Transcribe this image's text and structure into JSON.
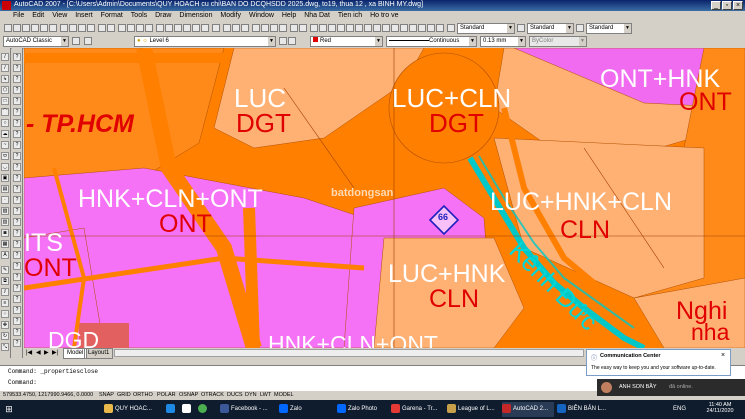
{
  "window": {
    "title": "AutoCAD 2007 - [C:\\Users\\Admin\\Documents\\QUY HOACH cu chi\\BAN DO DCQHSDD 2025.dwg, to19, thua 12 , xa BINH MY.dwg]"
  },
  "menu": [
    "File",
    "Edit",
    "View",
    "Insert",
    "Format",
    "Tools",
    "Draw",
    "Dimension",
    "Modify",
    "Window",
    "Help",
    "Nha Dat",
    "Tien ich",
    "Ho tro ve"
  ],
  "toolbar": {
    "text_style": "Standard",
    "dim_style": "Standard",
    "table_style": "Standard",
    "workspace": "AutoCAD Classic",
    "layer": "Level 6",
    "color": "Red",
    "linetype": "Continuous",
    "lineweight": "0.13 mm",
    "plotstyle": "ByColor"
  },
  "drawing": {
    "zones": [
      {
        "text": "LUC",
        "cls": "w"
      },
      {
        "text": "DGT",
        "cls": "r"
      },
      {
        "text": "LUC+CLN",
        "cls": "w"
      },
      {
        "text": "DGT",
        "cls": "r"
      },
      {
        "text": "ONT+HNK",
        "cls": "w"
      },
      {
        "text": "ONT",
        "cls": "r"
      },
      {
        "text": "- TP.HCM",
        "cls": "r"
      },
      {
        "text": "HNK+CLN+ONT",
        "cls": "w"
      },
      {
        "text": "ONT",
        "cls": "r"
      },
      {
        "text": "LUC+HNK+CLN",
        "cls": "w"
      },
      {
        "text": "CLN",
        "cls": "r"
      },
      {
        "text": "ITS",
        "cls": "w"
      },
      {
        "text": "ONT",
        "cls": "r"
      },
      {
        "text": "LUC+HNK",
        "cls": "w"
      },
      {
        "text": "CLN",
        "cls": "r"
      },
      {
        "text": "Kênh Đức",
        "cls": "c"
      },
      {
        "text": "Nghi",
        "cls": "r"
      },
      {
        "text": "nha",
        "cls": "r"
      },
      {
        "text": "DGD",
        "cls": "w"
      },
      {
        "text": "HNK+CLN+ONT",
        "cls": "w"
      }
    ],
    "plot_number": "66",
    "watermark": "batdongsan"
  },
  "layout_tabs": {
    "model": "Model",
    "layout": "Layout1"
  },
  "command": {
    "line1": "Command: _propertiesclose",
    "line2": "Command:"
  },
  "status": {
    "coords": "579533.4750, 1217990.9466, 0.0000",
    "toggles": [
      "SNAP",
      "GRID",
      "ORTHO",
      "POLAR",
      "OSNAP",
      "OTRACK",
      "DUCS",
      "DYN",
      "LWT",
      "MODEL"
    ]
  },
  "notification": {
    "title": "Communication Center",
    "body": "The easy way to keep you and your software up-to-date."
  },
  "skype": {
    "text": "ANH SON BẦY",
    "status": "đã online."
  },
  "taskbar": {
    "items": [
      {
        "label": "QUY HOAC...",
        "color": "#e8b84a"
      },
      {
        "label": "",
        "color": "#1e88e5"
      },
      {
        "label": "",
        "color": "#ffffff"
      },
      {
        "label": "",
        "color": "#4caf50"
      },
      {
        "label": "Facebook - ...",
        "color": "#3b5998"
      },
      {
        "label": "Zalo",
        "color": "#0068ff"
      },
      {
        "label": "Zalo Photo",
        "color": "#0068ff"
      },
      {
        "label": "Garena - Tr...",
        "color": "#e53935"
      },
      {
        "label": "League of L...",
        "color": "#c8a04a"
      },
      {
        "label": "AutoCAD 2...",
        "color": "#c62828"
      },
      {
        "label": "BIÊN BẢN L...",
        "color": "#1565c0"
      }
    ],
    "lang": "ENG",
    "time": "11:40 AM",
    "date": "24/11/2020"
  }
}
